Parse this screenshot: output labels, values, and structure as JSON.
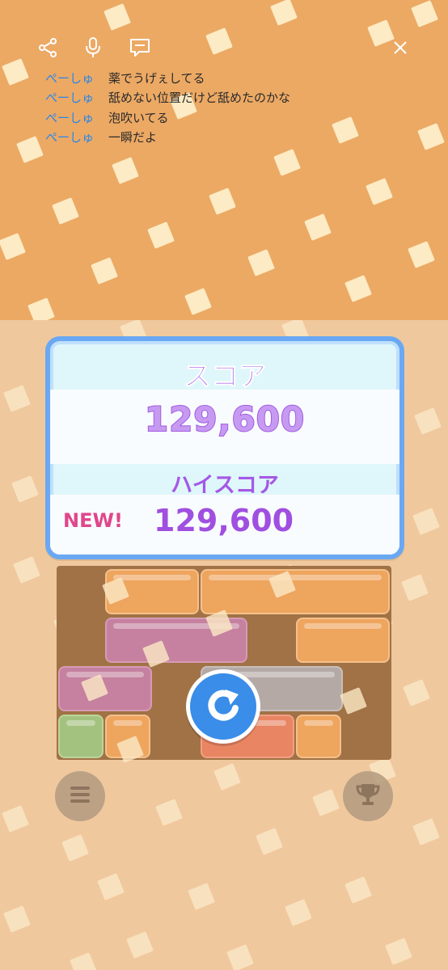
{
  "colors": {
    "top_background": "#eca964",
    "bottom_background": "#f0c597",
    "panel_border": "#6aa8f3",
    "score_purple": "#a458e6",
    "new_pink": "#e0468c",
    "comment_user": "#2a86e8"
  },
  "top_bar": {
    "icons": [
      "share-icon",
      "microphone-icon",
      "chat-icon",
      "close-icon"
    ]
  },
  "comments": [
    {
      "user": "ぺーしゅ",
      "text": "薬でうげぇしてる"
    },
    {
      "user": "ぺーしゅ",
      "text": "舐めない位置だけど舐めたのかな"
    },
    {
      "user": "ぺーしゅ",
      "text": "泡吹いてる"
    },
    {
      "user": "ぺーしゅ",
      "text": "一瞬だよ"
    }
  ],
  "score_panel": {
    "score_title": "スコア",
    "score_value": "129,600",
    "high_score_title": "ハイスコア",
    "new_badge": "NEW!",
    "high_score_value": "129,600"
  },
  "board": {
    "block_colors": [
      "orange",
      "pink",
      "green",
      "gray",
      "red"
    ]
  },
  "buttons": {
    "retry_icon": "retry-icon",
    "menu_icon": "menu-icon",
    "ranking_icon": "trophy-icon"
  }
}
